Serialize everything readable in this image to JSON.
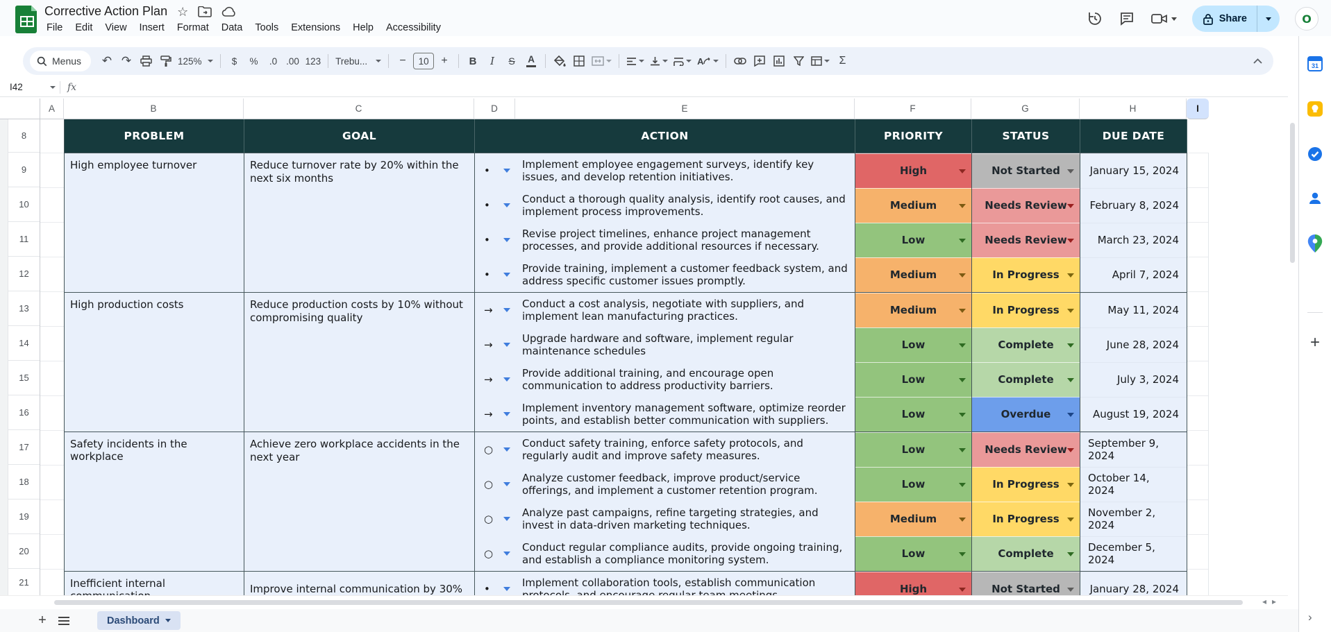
{
  "titlebar": {
    "doc_title": "Corrective Action Plan",
    "menu_items": [
      "File",
      "Edit",
      "View",
      "Insert",
      "Format",
      "Data",
      "Tools",
      "Extensions",
      "Help",
      "Accessibility"
    ],
    "share_label": "Share"
  },
  "toolbar": {
    "menus_label": "Menus",
    "zoom_value": "125%",
    "currency": "$",
    "percent": "%",
    "decrease_decimals": ".0",
    "increase_decimals": ".00",
    "more_formats": "123",
    "font_name": "Trebu...",
    "font_size": "10",
    "bold": "B",
    "italic": "I",
    "strikethrough": "S",
    "text_color": "A",
    "functions": "Σ"
  },
  "formula_bar": {
    "cell_ref": "I42",
    "fx_label": "fx"
  },
  "sheet": {
    "column_letters": [
      "A",
      "B",
      "C",
      "D",
      "E",
      "F",
      "G",
      "H",
      "I"
    ],
    "selected_column": "I",
    "row_numbers": [
      "8",
      "9",
      "10",
      "11",
      "12",
      "13",
      "14",
      "15",
      "16",
      "17",
      "18",
      "19",
      "20",
      "21"
    ],
    "header": {
      "problem": "PROBLEM",
      "goal": "GOAL",
      "action": "ACTION",
      "priority": "PRIORITY",
      "status": "STATUS",
      "due": "DUE DATE"
    },
    "groups": [
      {
        "problem": "High employee turnover",
        "goal": "Reduce turnover rate by 20% within the next six months",
        "bullet": "•",
        "items": [
          {
            "action": "Implement employee engagement surveys, identify key issues, and develop retention initiatives.",
            "priority": "High",
            "status": "Not Started",
            "due": "January 15, 2024"
          },
          {
            "action": "Conduct a thorough quality analysis, identify root causes, and implement process improvements.",
            "priority": "Medium",
            "status": "Needs Review",
            "due": "February 8, 2024"
          },
          {
            "action": "Revise project timelines, enhance project management processes, and provide additional resources if necessary.",
            "priority": "Low",
            "status": "Needs Review",
            "due": "March 23, 2024"
          },
          {
            "action": "Provide training, implement a customer feedback system, and address specific customer issues promptly.",
            "priority": "Medium",
            "status": "In Progress",
            "due": "April 7, 2024"
          }
        ]
      },
      {
        "problem": "High production costs",
        "goal": "Reduce production costs by 10% without compromising quality",
        "bullet": "→",
        "items": [
          {
            "action": "Conduct a cost analysis, negotiate with suppliers, and implement lean manufacturing practices.",
            "priority": "Medium",
            "status": "In Progress",
            "due": "May 11, 2024"
          },
          {
            "action": "Upgrade hardware and software, implement regular maintenance schedules",
            "priority": "Low",
            "status": "Complete",
            "due": "June 28, 2024"
          },
          {
            "action": "Provide additional training, and encourage open communication to address productivity barriers.",
            "priority": "Low",
            "status": "Complete",
            "due": "July 3, 2024"
          },
          {
            "action": "Implement inventory management software, optimize reorder points, and establish better communication with suppliers.",
            "priority": "Low",
            "status": "Overdue",
            "due": "August 19, 2024"
          }
        ]
      },
      {
        "problem": "Safety incidents in the workplace",
        "goal": "Achieve zero workplace accidents in the next year",
        "bullet": "○",
        "items": [
          {
            "action": "Conduct safety training, enforce safety protocols, and regularly audit and improve safety measures.",
            "priority": "Low",
            "status": "Needs Review",
            "due": "September 9, 2024"
          },
          {
            "action": "Analyze customer feedback, improve product/service offerings, and implement a customer retention program.",
            "priority": "Low",
            "status": "In Progress",
            "due": "October 14, 2024"
          },
          {
            "action": "Analyze past campaigns, refine targeting strategies, and invest in data-driven marketing techniques.",
            "priority": "Medium",
            "status": "In Progress",
            "due": "November 2, 2024"
          },
          {
            "action": "Conduct regular compliance audits, provide ongoing training, and establish a compliance monitoring system.",
            "priority": "Low",
            "status": "Complete",
            "due": "December 5, 2024"
          }
        ]
      },
      {
        "problem": "Inefficient internal communication",
        "goal": "Improve internal communication by 30%",
        "bullet": "•",
        "items": [
          {
            "action": "Implement collaboration tools, establish communication protocols, and encourage regular team meetings.",
            "priority": "High",
            "status": "Not Started",
            "due": "January 28, 2024"
          }
        ]
      }
    ]
  },
  "tab_bar": {
    "active_tab": "Dashboard"
  },
  "colors": {
    "table_header_bg": "#163a3d",
    "row_bg": "#e9f0fb",
    "priority": {
      "High": "#e06666",
      "Medium": "#f6b26b",
      "Low": "#93c47d"
    },
    "status": {
      "Not Started": "#b7b7b7",
      "Needs Review": "#ea9999",
      "In Progress": "#ffd966",
      "Complete": "#b6d7a8",
      "Overdue": "#6d9eeb"
    },
    "share_button_bg": "#c2e7ff"
  },
  "side_panel": {
    "icons": [
      "calendar",
      "keep",
      "tasks",
      "contacts",
      "maps",
      "add"
    ]
  }
}
